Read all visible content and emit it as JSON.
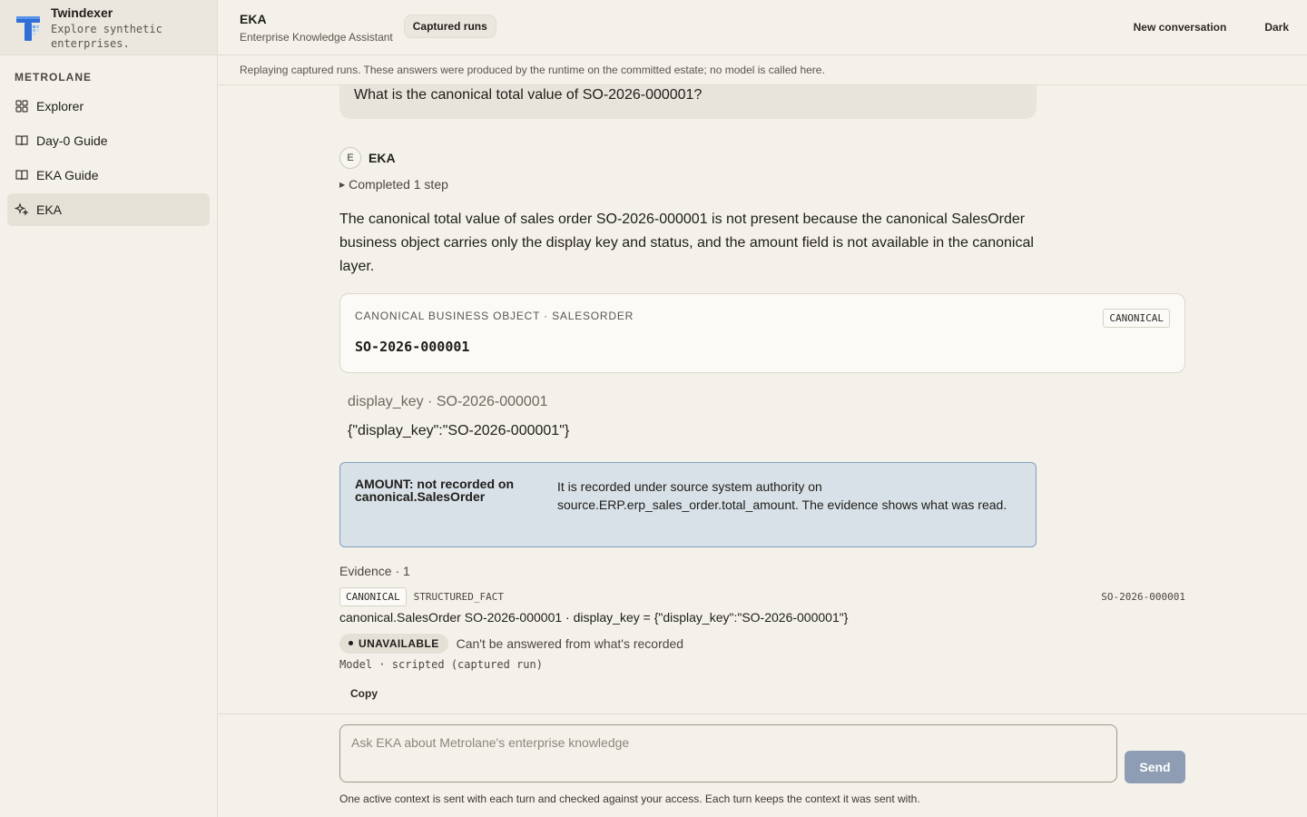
{
  "brand": {
    "name": "Twindexer",
    "tagline": "Explore synthetic enterprises."
  },
  "sidebar": {
    "org": "METROLANE",
    "items": [
      {
        "label": "Explorer",
        "icon": "grid-icon"
      },
      {
        "label": "Day-0 Guide",
        "icon": "book-icon"
      },
      {
        "label": "EKA Guide",
        "icon": "book-icon"
      },
      {
        "label": "EKA",
        "icon": "sparkle-icon",
        "active": true
      }
    ]
  },
  "header": {
    "title": "EKA",
    "subtitle": "Enterprise Knowledge Assistant",
    "badge": "Captured runs",
    "new_conversation": "New conversation",
    "theme": "Dark"
  },
  "notice": "Replaying captured runs. These answers were produced by the runtime on the committed estate; no model is called here.",
  "conversation": {
    "question": "What is the canonical total value of SO-2026-000001?",
    "assistant_initial": "E",
    "assistant_name": "EKA",
    "steps": "Completed 1 step",
    "answer": "The canonical total value of sales order SO-2026-000001 is not present because the canonical SalesOrder business object carries only the display key and status, and the amount field is not available in the canonical layer.",
    "object_card": {
      "kicker": "CANONICAL BUSINESS OBJECT · SALESORDER",
      "key": "SO-2026-000001",
      "tag": "CANONICAL"
    },
    "field": {
      "label": "display_key · SO-2026-000001",
      "value": "{\"display_key\":\"SO-2026-000001\"}"
    },
    "alert": {
      "title": "AMOUNT: not recorded on canonical.SalesOrder",
      "body": "It is recorded under source system authority on source.ERP.erp_sales_order.total_amount. The evidence shows what was read."
    },
    "evidence": {
      "heading": "Evidence · 1",
      "tag": "CANONICAL",
      "kind": "STRUCTURED_FACT",
      "id": "SO-2026-000001",
      "line": "canonical.SalesOrder SO-2026-000001 · display_key = {\"display_key\":\"SO-2026-000001\"}"
    },
    "status": {
      "label": "UNAVAILABLE",
      "text": "Can't be answered from what's recorded"
    },
    "model": "Model · scripted (captured run)",
    "copy": "Copy"
  },
  "composer": {
    "placeholder": "Ask EKA about Metrolane's enterprise knowledge",
    "send": "Send",
    "footnote": "One active context is sent with each turn and checked against your access. Each turn keeps the context it was sent with."
  },
  "colors": {
    "accent": "#8e9db3",
    "alert_bg": "#d8e1e7",
    "alert_border": "#7e9fbf",
    "logo": "#2f6fd6"
  }
}
